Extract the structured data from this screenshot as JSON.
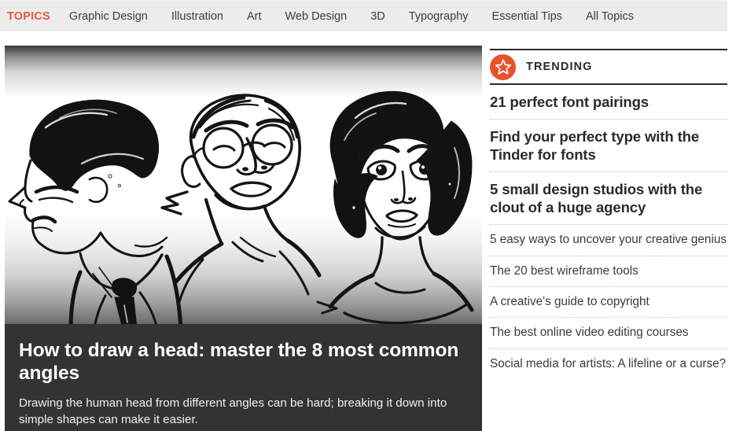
{
  "nav": {
    "label": "TOPICS",
    "label_color": "#e8573f",
    "bar_color": "#ececec",
    "items": [
      {
        "label": "Graphic Design"
      },
      {
        "label": "Illustration"
      },
      {
        "label": "Art"
      },
      {
        "label": "Web Design"
      },
      {
        "label": "3D"
      },
      {
        "label": "Typography"
      },
      {
        "label": "Essential Tips"
      },
      {
        "label": "All Topics"
      }
    ]
  },
  "hero": {
    "image_alt": "Black and white ink illustration of three heads drawn from different angles: a man in a suit and tie in profile, a person with round glasses looking up, and a woman facing forward",
    "title": "How to draw a head: master the 8 most common angles",
    "description": "Drawing the human head from different angles can be hard; breaking it down into simple shapes can make it easier.",
    "overlay_color": "#333333"
  },
  "trending": {
    "heading": "TRENDING",
    "badge_icon": "star-icon",
    "badge_color": "#e8522e",
    "items": [
      {
        "title": "21 perfect font pairings",
        "style": "lead"
      },
      {
        "title": "Find your perfect type with the Tinder for fonts",
        "style": "lead"
      },
      {
        "title": "5 small design studios with the clout of a huge agency",
        "style": "lead"
      },
      {
        "title": "5 easy ways to uncover your creative genius",
        "style": "plain"
      },
      {
        "title": "The 20 best wireframe tools",
        "style": "plain"
      },
      {
        "title": "A creative's guide to copyright",
        "style": "plain"
      },
      {
        "title": "The best online video editing courses",
        "style": "plain"
      },
      {
        "title": "Social media for artists: A lifeline or a curse?",
        "style": "plain"
      }
    ]
  }
}
